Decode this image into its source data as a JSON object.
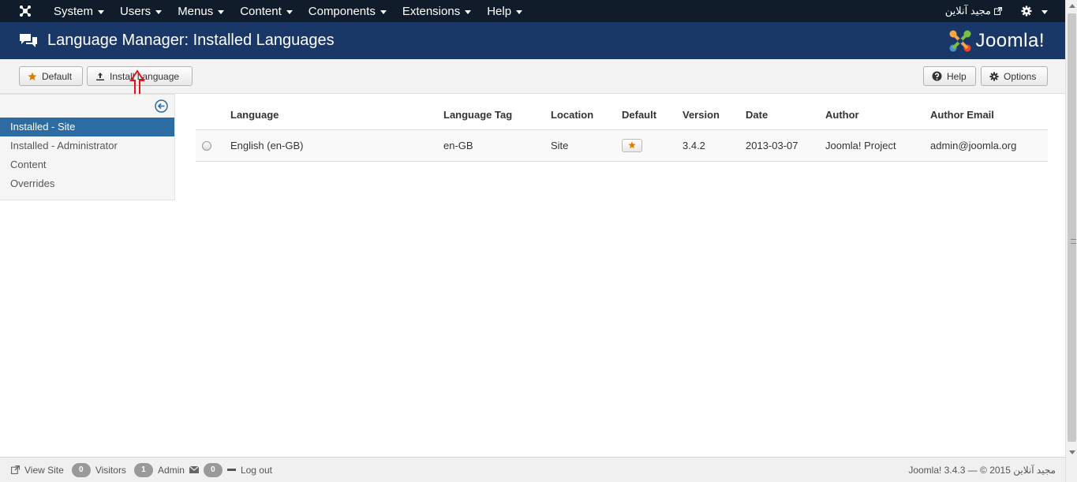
{
  "navbar": {
    "menus": [
      "System",
      "Users",
      "Menus",
      "Content",
      "Components",
      "Extensions",
      "Help"
    ],
    "user": "مجید آنلاین"
  },
  "header": {
    "title": "Language Manager: Installed Languages",
    "brand": "Joomla!"
  },
  "toolbar": {
    "default_label": "Default",
    "install_label": "Install Language",
    "help_label": "Help",
    "options_label": "Options"
  },
  "sidebar": {
    "items": [
      "Installed - Site",
      "Installed - Administrator",
      "Content",
      "Overrides"
    ],
    "active": 0
  },
  "table": {
    "headers": [
      "Language",
      "Language Tag",
      "Location",
      "Default",
      "Version",
      "Date",
      "Author",
      "Author Email"
    ],
    "rows": [
      {
        "language": "English (en-GB)",
        "tag": "en-GB",
        "location": "Site",
        "version": "3.4.2",
        "date": "2013-03-07",
        "author": "Joomla! Project",
        "email": "admin@joomla.org"
      }
    ]
  },
  "footer": {
    "view_site": "View Site",
    "visitors_count": "0",
    "visitors_label": "Visitors",
    "admin_count": "1",
    "admin_label": "Admin",
    "messages_count": "0",
    "logout_label": "Log out",
    "copyright": "Joomla! 3.4.3 — © 2015 مجید آنلاین"
  },
  "colors": {
    "navbar": "#111c2b",
    "header": "#1a3867",
    "active": "#2d6ca2",
    "star": "#e07b00",
    "annotation": "#e0121a"
  }
}
